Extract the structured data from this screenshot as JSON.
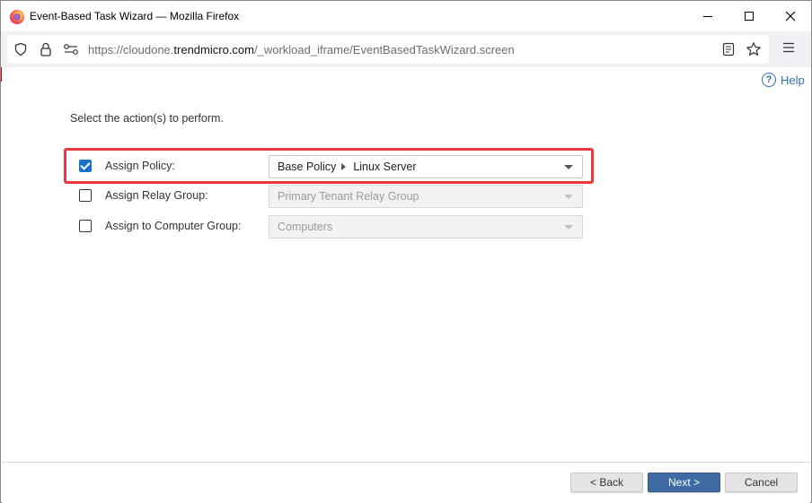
{
  "window": {
    "title": "Event-Based Task Wizard — Mozilla Firefox"
  },
  "urlbar": {
    "url_prefix": "https://cloudone.",
    "url_domain": "trendmicro.com",
    "url_path": "/_workload_iframe/EventBasedTaskWizard.screen"
  },
  "help": {
    "label": "Help",
    "icon": "question-circle-icon"
  },
  "wizard": {
    "instructions": "Select the action(s) to perform.",
    "actions": [
      {
        "label": "Assign Policy:",
        "checked": true,
        "enabled": true,
        "value_parent": "Base Policy",
        "value_child": "Linux Server"
      },
      {
        "label": "Assign Relay Group:",
        "checked": false,
        "enabled": false,
        "value": "Primary Tenant Relay Group"
      },
      {
        "label": "Assign to Computer Group:",
        "checked": false,
        "enabled": false,
        "value": "Computers"
      }
    ]
  },
  "footer": {
    "back_label": "< Back",
    "next_label": "Next >",
    "cancel_label": "Cancel"
  },
  "colors": {
    "highlight": "#e8393e",
    "primary_button": "#3f6ba4",
    "link": "#2f6fb5",
    "checkbox_checked": "#1a73c8"
  }
}
